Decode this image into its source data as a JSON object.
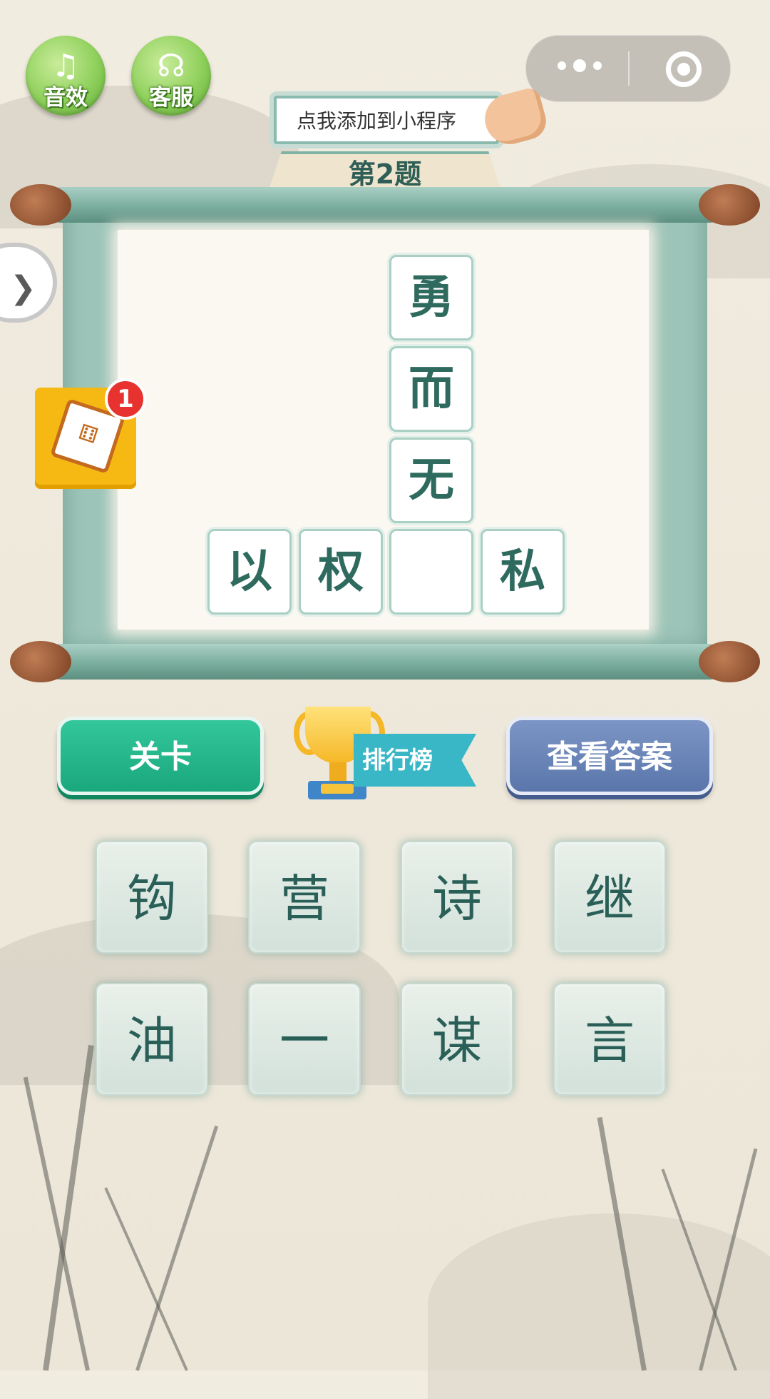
{
  "header": {
    "sound_label": "音效",
    "service_label": "客服",
    "add_tip": "点我添加到小程序",
    "level_title": "第2题"
  },
  "side": {
    "badge_count": "1"
  },
  "puzzle": {
    "vertical": [
      "勇",
      "而",
      "无"
    ],
    "horizontal": [
      "以",
      "权",
      "",
      "私"
    ]
  },
  "actions": {
    "level_label": "关卡",
    "rank_label": "排行榜",
    "answer_label": "查看答案"
  },
  "candidates": [
    "钩",
    "营",
    "诗",
    "继",
    "油",
    "一",
    "谋",
    "言"
  ],
  "colors": {
    "accent_green": "#1aa77c",
    "accent_blue": "#5a76aa",
    "tile_text": "#2f6a5e"
  }
}
